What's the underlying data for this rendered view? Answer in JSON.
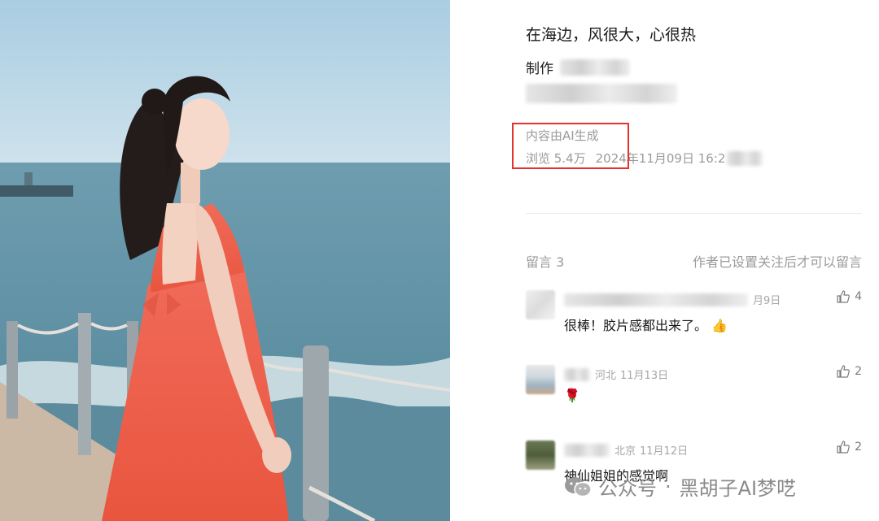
{
  "post": {
    "title": "在海边，风很大，心很热",
    "maker_label": "制作",
    "ai_tag": "内容由AI生成",
    "views": "浏览 5.4万",
    "date": "2024年11月09日 16:2"
  },
  "comments_header": {
    "count": "留言 3",
    "notice": "作者已设置关注后才可以留言"
  },
  "comments": [
    {
      "location": "",
      "date": "月9日",
      "text": "很棒！胶片感都出来了。",
      "likes": "4"
    },
    {
      "location": "河北",
      "date": "11月13日",
      "text": "🌹",
      "likes": "2"
    },
    {
      "location": "北京",
      "date": "11月12日",
      "text": "神仙姐姐的感觉啊",
      "likes": "2"
    }
  ],
  "watermark": {
    "account": "公众号",
    "separator": "·",
    "name": "黑胡子AI梦呓"
  },
  "colors": {
    "highlight_box": "#e5322d",
    "meta_gray": "#9b9b9b",
    "dress": "#f0624f",
    "sea": "#5e8fa3",
    "sky": "#b9d6e6"
  },
  "icons": {
    "like": "thumbs-up-icon",
    "watermark_logo": "wechat-icon"
  }
}
